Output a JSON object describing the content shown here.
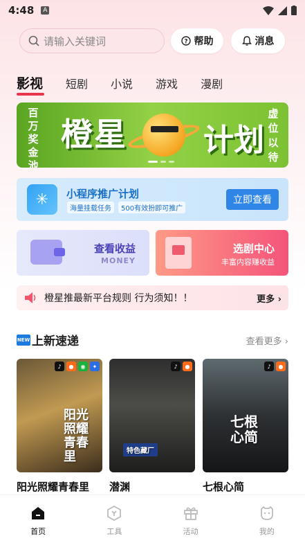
{
  "status": {
    "time": "4:48"
  },
  "search": {
    "placeholder": "请输入关键词"
  },
  "header": {
    "help_label": "帮助",
    "msg_label": "消息"
  },
  "tabs": [
    {
      "label": "影视",
      "active": true
    },
    {
      "label": "短剧"
    },
    {
      "label": "小说"
    },
    {
      "label": "游戏"
    },
    {
      "label": "漫剧"
    }
  ],
  "banner": {
    "left_text": "百万奖金池",
    "title_a": "橙星",
    "title_b": "计划",
    "right_text": "虚位以待"
  },
  "mini_program": {
    "title": "小程序推广计划",
    "tag1": "海量挂载任务",
    "tag2": "500有效扮即可推广",
    "button": "立即查看"
  },
  "earnings": {
    "title": "查看收益",
    "sub": "MONEY"
  },
  "drama_center": {
    "title": "选剧中心",
    "sub": "丰富内容赚收益"
  },
  "notice": {
    "text": "橙星推最新平台规则 行为须知！！",
    "more": "更多"
  },
  "section": {
    "title": "上新速递",
    "badge": "NEW",
    "more": "查看更多"
  },
  "posters": [
    {
      "title": "阳光照耀青春里",
      "overlay": "阳光照耀青春里",
      "badges": [
        "tiktok",
        "kuaishou",
        "wechat",
        "baidu"
      ]
    },
    {
      "title": "潜渊",
      "overlay": "特色藏厂",
      "badges": [
        "tiktok",
        "kuaishou"
      ]
    },
    {
      "title": "七根心简",
      "overlay": "七根心简",
      "badges": [
        "tiktok",
        "kuaishou"
      ]
    }
  ],
  "nav": [
    {
      "label": "首页",
      "icon": "home-icon",
      "active": true
    },
    {
      "label": "工具",
      "icon": "tool-icon"
    },
    {
      "label": "活动",
      "icon": "gift-icon"
    },
    {
      "label": "我的",
      "icon": "profile-icon"
    }
  ],
  "colors": {
    "accent": "#e8344c",
    "blue": "#2f86e6",
    "banner_green": "#7cc233"
  }
}
